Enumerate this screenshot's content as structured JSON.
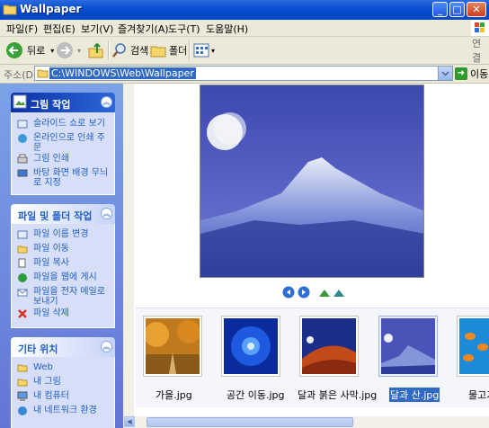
{
  "window": {
    "title": "Wallpaper"
  },
  "menu": [
    "파일(F)",
    "편집(E)",
    "보기(V)",
    "즐겨찾기(A)",
    "도구(T)",
    "도움말(H)"
  ],
  "toolbar": {
    "back": "뒤로",
    "search": "검색",
    "folders": "폴더",
    "links": "연결"
  },
  "address": {
    "label": "주소(D)",
    "value": "C:\\WINDOWS\\Web\\Wallpaper",
    "go": "이동"
  },
  "tasks": {
    "picture": {
      "title": "그림 작업",
      "items": [
        "슬라이드 쇼로 보기",
        "온라인으로 인쇄 주문",
        "그림 인쇄",
        "바탕 화면 배경 무늬로 지정"
      ]
    },
    "file": {
      "title": "파일 및 폴더 작업",
      "items": [
        "파일 이름 변경",
        "파일 이동",
        "파일 복사",
        "파일을 웹에 게시",
        "파일을 전자 메일로 보내기",
        "파일 삭제"
      ]
    },
    "other": {
      "title": "기타 위치",
      "items": [
        "Web",
        "내 그림",
        "내 컴퓨터",
        "내 네트워크 환경"
      ]
    }
  },
  "thumbnails": [
    {
      "label": "가을.jpg"
    },
    {
      "label": "공간 이동.jpg"
    },
    {
      "label": "달과 붉은 사막.jpg"
    },
    {
      "label": "달과 산.jpg",
      "selected": true
    },
    {
      "label": "물고기"
    }
  ]
}
